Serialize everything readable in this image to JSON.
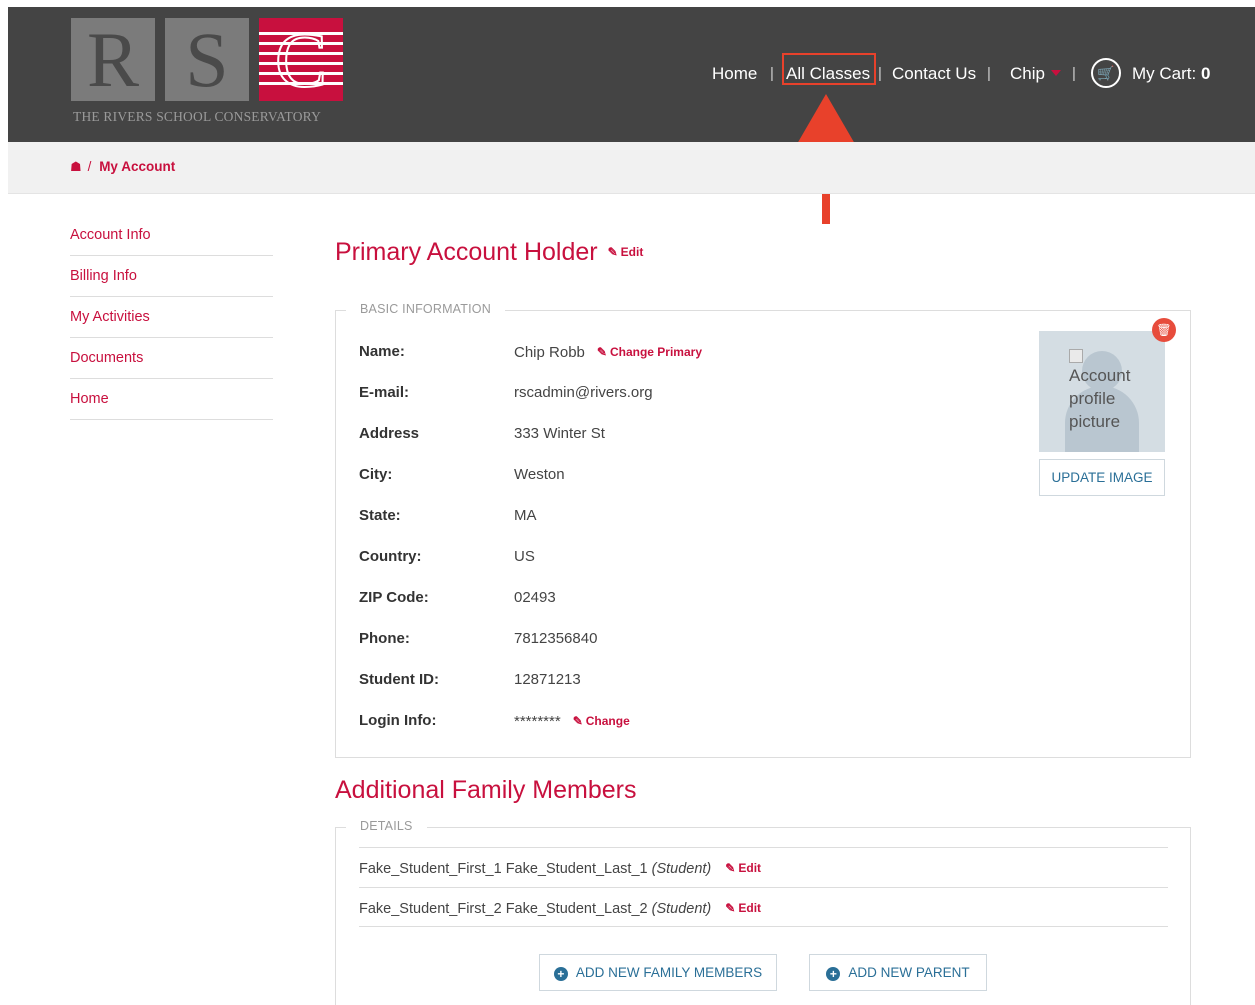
{
  "header": {
    "logo": {
      "letters": [
        "R",
        "S",
        "C"
      ],
      "tagline": "THE RIVERS SCHOOL CONSERVATORY"
    },
    "nav": {
      "home": "Home",
      "all_classes": "All Classes",
      "contact": "Contact Us",
      "user": "Chip",
      "cart_label": "My Cart:",
      "cart_count": "0",
      "separator": "|"
    }
  },
  "breadcrumb": {
    "separator": "/",
    "current": "My Account"
  },
  "sidebar": {
    "items": [
      {
        "label": "Account Info"
      },
      {
        "label": "Billing Info"
      },
      {
        "label": "My Activities"
      },
      {
        "label": "Documents"
      },
      {
        "label": "Home"
      }
    ]
  },
  "primary": {
    "title": "Primary Account Holder",
    "edit_label": "Edit",
    "legend": "BASIC INFORMATION",
    "fields": [
      {
        "label": "Name:",
        "value": "Chip Robb",
        "action": "Change Primary"
      },
      {
        "label": "E-mail:",
        "value": "rscadmin@rivers.org"
      },
      {
        "label": "Address",
        "value": "333 Winter St"
      },
      {
        "label": "City:",
        "value": "Weston"
      },
      {
        "label": "State:",
        "value": "MA"
      },
      {
        "label": "Country:",
        "value": "US"
      },
      {
        "label": "ZIP Code:",
        "value": "02493"
      },
      {
        "label": "Phone:",
        "value": "7812356840"
      },
      {
        "label": "Student ID:",
        "value": "12871213"
      },
      {
        "label": "Login Info:",
        "value": "********",
        "action": "Change"
      }
    ],
    "avatar_alt": "Account profile picture",
    "update_image_label": "UPDATE IMAGE"
  },
  "family": {
    "title": "Additional Family Members",
    "legend": "DETAILS",
    "members": [
      {
        "name": "Fake_Student_First_1 Fake_Student_Last_1",
        "role": "(Student)",
        "edit_label": "Edit"
      },
      {
        "name": "Fake_Student_First_2 Fake_Student_Last_2",
        "role": "(Student)",
        "edit_label": "Edit"
      }
    ],
    "add_family_label": "ADD NEW FAMILY MEMBERS",
    "add_parent_label": "ADD NEW PARENT"
  },
  "colors": {
    "brand": "#c8103e",
    "header_bg": "#444444",
    "annotation": "#e8412b",
    "button_text": "#2a6f97"
  }
}
